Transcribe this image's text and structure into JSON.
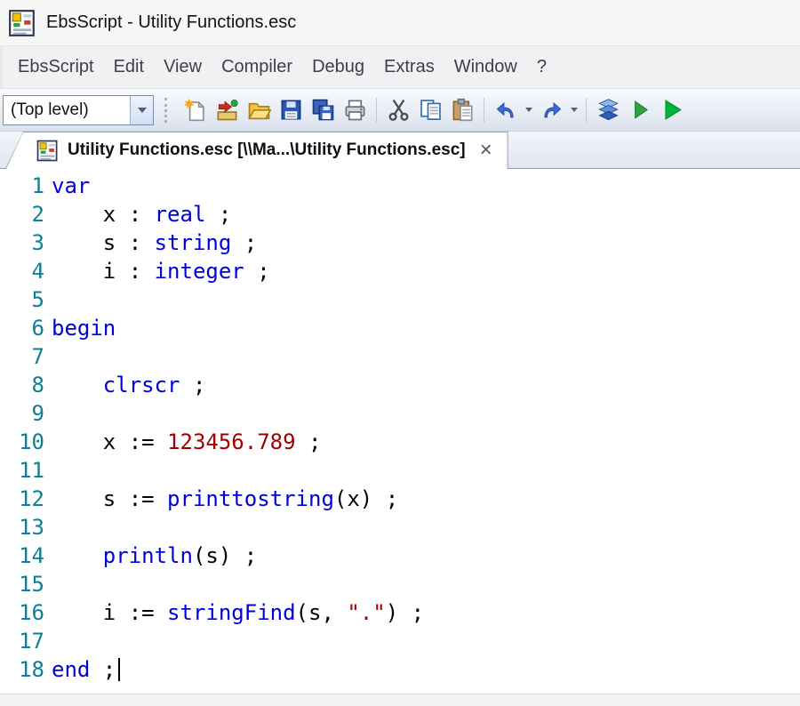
{
  "window": {
    "title": "EbsScript - Utility Functions.esc"
  },
  "menu": {
    "items": [
      {
        "label": "EbsScript"
      },
      {
        "label": "Edit"
      },
      {
        "label": "View"
      },
      {
        "label": "Compiler"
      },
      {
        "label": "Debug"
      },
      {
        "label": "Extras"
      },
      {
        "label": "Window"
      },
      {
        "label": "?"
      }
    ]
  },
  "toolbar": {
    "scope_selector": {
      "value": "(Top level)"
    },
    "buttons": [
      {
        "name": "new-file-icon"
      },
      {
        "name": "open-project-icon"
      },
      {
        "name": "open-file-icon"
      },
      {
        "name": "save-icon"
      },
      {
        "name": "save-all-icon"
      },
      {
        "name": "print-icon"
      },
      {
        "name": "cut-icon"
      },
      {
        "name": "copy-icon"
      },
      {
        "name": "paste-icon"
      },
      {
        "name": "undo-icon",
        "dropdown": true
      },
      {
        "name": "redo-icon",
        "dropdown": true
      },
      {
        "name": "compile-icon"
      },
      {
        "name": "run-icon"
      },
      {
        "name": "start-icon"
      }
    ]
  },
  "tabs": {
    "active": {
      "title": "Utility Functions.esc [\\\\Ma...\\Utility Functions.esc]",
      "close_label": "×"
    }
  },
  "editor": {
    "lines": [
      {
        "num": "1",
        "tokens": [
          {
            "t": "var",
            "c": "kw"
          }
        ]
      },
      {
        "num": "2",
        "tokens": [
          {
            "t": "    x : ",
            "c": "pl"
          },
          {
            "t": "real",
            "c": "kw"
          },
          {
            "t": " ;",
            "c": "pl"
          }
        ]
      },
      {
        "num": "3",
        "tokens": [
          {
            "t": "    s : ",
            "c": "pl"
          },
          {
            "t": "string",
            "c": "kw"
          },
          {
            "t": " ;",
            "c": "pl"
          }
        ]
      },
      {
        "num": "4",
        "tokens": [
          {
            "t": "    i : ",
            "c": "pl"
          },
          {
            "t": "integer",
            "c": "kw"
          },
          {
            "t": " ;",
            "c": "pl"
          }
        ]
      },
      {
        "num": "5",
        "tokens": []
      },
      {
        "num": "6",
        "tokens": [
          {
            "t": "begin",
            "c": "kw"
          }
        ]
      },
      {
        "num": "7",
        "tokens": []
      },
      {
        "num": "8",
        "tokens": [
          {
            "t": "    ",
            "c": "pl"
          },
          {
            "t": "clrscr",
            "c": "fn"
          },
          {
            "t": " ;",
            "c": "pl"
          }
        ]
      },
      {
        "num": "9",
        "tokens": []
      },
      {
        "num": "10",
        "tokens": [
          {
            "t": "    x := ",
            "c": "pl"
          },
          {
            "t": "123456.789",
            "c": "num"
          },
          {
            "t": " ;",
            "c": "pl"
          }
        ]
      },
      {
        "num": "11",
        "tokens": []
      },
      {
        "num": "12",
        "tokens": [
          {
            "t": "    s := ",
            "c": "pl"
          },
          {
            "t": "printtostring",
            "c": "fn"
          },
          {
            "t": "(x) ;",
            "c": "pl"
          }
        ]
      },
      {
        "num": "13",
        "tokens": []
      },
      {
        "num": "14",
        "tokens": [
          {
            "t": "    ",
            "c": "pl"
          },
          {
            "t": "println",
            "c": "fn"
          },
          {
            "t": "(s) ;",
            "c": "pl"
          }
        ]
      },
      {
        "num": "15",
        "tokens": []
      },
      {
        "num": "16",
        "tokens": [
          {
            "t": "    i := ",
            "c": "pl"
          },
          {
            "t": "stringFind",
            "c": "fn"
          },
          {
            "t": "(s, ",
            "c": "pl"
          },
          {
            "t": "\".\"",
            "c": "str"
          },
          {
            "t": ") ;",
            "c": "pl"
          }
        ]
      },
      {
        "num": "17",
        "tokens": []
      },
      {
        "num": "18",
        "tokens": [
          {
            "t": "end",
            "c": "kw"
          },
          {
            "t": " ;",
            "c": "pl"
          }
        ],
        "cursor": true
      }
    ]
  },
  "colors": {
    "keyword": "#0000dd",
    "function": "#0000dd",
    "number": "#a00000",
    "string": "#a00000",
    "plain": "#000000",
    "line-number": "#0c7f95"
  }
}
